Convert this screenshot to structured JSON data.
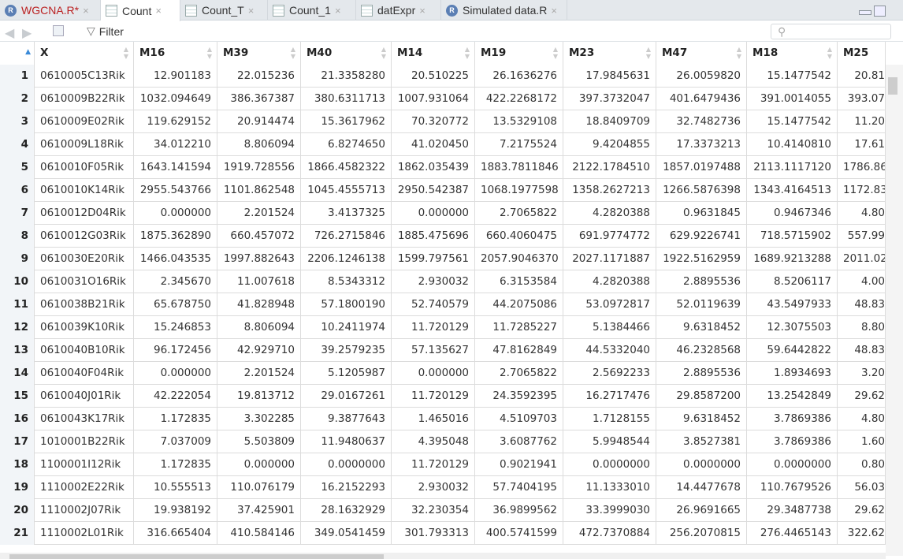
{
  "tabs": [
    {
      "label": "WGCNA.R*",
      "icon": "r-script-icon",
      "modified": true
    },
    {
      "label": "Count",
      "icon": "table-icon",
      "active": true
    },
    {
      "label": "Count_T",
      "icon": "table-icon"
    },
    {
      "label": "Count_1",
      "icon": "table-icon"
    },
    {
      "label": "datExpr",
      "icon": "table-icon"
    },
    {
      "label": "Simulated data.R",
      "icon": "r-script-icon"
    }
  ],
  "toolbar": {
    "filter_label": "Filter",
    "search_placeholder": ""
  },
  "columns": [
    "",
    "X",
    "M16",
    "M39",
    "M40",
    "M14",
    "M19",
    "M23",
    "M47",
    "M18",
    "M25"
  ],
  "rows": [
    [
      "1",
      "0610005C13Rik",
      "12.901183",
      "22.015236",
      "21.3358280",
      "20.510225",
      "26.1636276",
      "17.9845631",
      "26.0059820",
      "15.1477542",
      "20.81"
    ],
    [
      "2",
      "0610009B22Rik",
      "1032.094649",
      "386.367387",
      "380.6311713",
      "1007.931064",
      "422.2268172",
      "397.3732047",
      "401.6479436",
      "391.0014055",
      "393.07"
    ],
    [
      "3",
      "0610009E02Rik",
      "119.629152",
      "20.914474",
      "15.3617962",
      "70.320772",
      "13.5329108",
      "18.8409709",
      "32.7482736",
      "15.1477542",
      "11.20"
    ],
    [
      "4",
      "0610009L18Rik",
      "34.012210",
      "8.806094",
      "6.8274650",
      "41.020450",
      "7.2175524",
      "9.4204855",
      "17.3373213",
      "10.4140810",
      "17.61"
    ],
    [
      "5",
      "0610010F05Rik",
      "1643.141594",
      "1919.728556",
      "1866.4582322",
      "1862.035439",
      "1883.7811846",
      "2122.1784510",
      "1857.0197488",
      "2113.1117120",
      "1786.86"
    ],
    [
      "6",
      "0610010K14Rik",
      "2955.543766",
      "1101.862548",
      "1045.4555713",
      "2950.542387",
      "1068.1977598",
      "1358.2627213",
      "1266.5876398",
      "1343.4164513",
      "1172.83"
    ],
    [
      "7",
      "0610012D04Rik",
      "0.000000",
      "2.201524",
      "3.4137325",
      "0.000000",
      "2.7065822",
      "4.2820388",
      "0.9631845",
      "0.9467346",
      "4.80"
    ],
    [
      "8",
      "0610012G03Rik",
      "1875.362890",
      "660.457072",
      "726.2715846",
      "1885.475696",
      "660.4060475",
      "691.9774772",
      "629.9226741",
      "718.5715902",
      "557.99"
    ],
    [
      "9",
      "0610030E20Rik",
      "1466.043535",
      "1997.882643",
      "2206.1246138",
      "1599.797561",
      "2057.9046370",
      "2027.1171887",
      "1922.5162959",
      "1689.9213288",
      "2011.02"
    ],
    [
      "10",
      "0610031O16Rik",
      "2.345670",
      "11.007618",
      "8.5343312",
      "2.930032",
      "6.3153584",
      "4.2820388",
      "2.8895536",
      "8.5206117",
      "4.00"
    ],
    [
      "11",
      "0610038B21Rik",
      "65.678750",
      "41.828948",
      "57.1800190",
      "52.740579",
      "44.2075086",
      "53.0972817",
      "52.0119639",
      "43.5497933",
      "48.83"
    ],
    [
      "12",
      "0610039K10Rik",
      "15.246853",
      "8.806094",
      "10.2411974",
      "11.720129",
      "11.7285227",
      "5.1384466",
      "9.6318452",
      "12.3075503",
      "8.80"
    ],
    [
      "13",
      "0610040B10Rik",
      "96.172456",
      "42.929710",
      "39.2579235",
      "57.135627",
      "47.8162849",
      "44.5332040",
      "46.2328568",
      "59.6442822",
      "48.83"
    ],
    [
      "14",
      "0610040F04Rik",
      "0.000000",
      "2.201524",
      "5.1205987",
      "0.000000",
      "2.7065822",
      "2.5692233",
      "2.8895536",
      "1.8934693",
      "3.20"
    ],
    [
      "15",
      "0610040J01Rik",
      "42.222054",
      "19.813712",
      "29.0167261",
      "11.720129",
      "24.3592395",
      "16.2717476",
      "29.8587200",
      "13.2542849",
      "29.62"
    ],
    [
      "16",
      "0610043K17Rik",
      "1.172835",
      "3.302285",
      "9.3877643",
      "1.465016",
      "4.5109703",
      "1.7128155",
      "9.6318452",
      "3.7869386",
      "4.80"
    ],
    [
      "17",
      "1010001B22Rik",
      "7.037009",
      "5.503809",
      "11.9480637",
      "4.395048",
      "3.6087762",
      "5.9948544",
      "3.8527381",
      "3.7869386",
      "1.60"
    ],
    [
      "18",
      "1100001I12Rik",
      "1.172835",
      "0.000000",
      "0.0000000",
      "11.720129",
      "0.9021941",
      "0.0000000",
      "0.0000000",
      "0.0000000",
      "0.80"
    ],
    [
      "19",
      "1110002E22Rik",
      "10.555513",
      "110.076179",
      "16.2152293",
      "2.930032",
      "57.7404195",
      "11.1333010",
      "14.4477678",
      "110.7679526",
      "56.03"
    ],
    [
      "20",
      "1110002J07Rik",
      "19.938192",
      "37.425901",
      "28.1632929",
      "32.230354",
      "36.9899562",
      "33.3999030",
      "26.9691665",
      "29.3487738",
      "29.62"
    ],
    [
      "21",
      "1110002L01Rik",
      "316.665404",
      "410.584146",
      "349.0541459",
      "301.793313",
      "400.5741599",
      "472.7370884",
      "256.2070815",
      "276.4465143",
      "322.62"
    ]
  ]
}
